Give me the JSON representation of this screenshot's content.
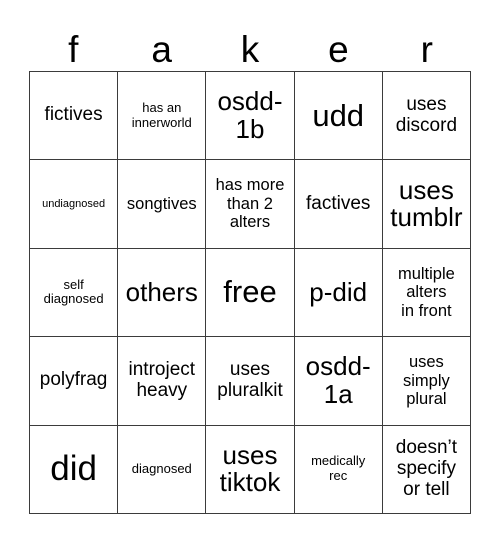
{
  "card": {
    "title_letters": [
      "f",
      "a",
      "k",
      "e",
      "r"
    ],
    "columns": 5,
    "rows": 5,
    "border_color": "#3b3b3b",
    "background_color": "#ffffff",
    "text_color": "#000000"
  },
  "cells": [
    {
      "text": "fictives",
      "size": "l"
    },
    {
      "text": "has an\ninnerworld",
      "size": "s"
    },
    {
      "text": "osdd-\n1b",
      "size": "xxl"
    },
    {
      "text": "udd",
      "size": "3xl"
    },
    {
      "text": "uses\ndiscord",
      "size": "l"
    },
    {
      "text": "undiagnosed",
      "size": "xs"
    },
    {
      "text": "songtives",
      "size": "m"
    },
    {
      "text": "has more\nthan 2\nalters",
      "size": "m"
    },
    {
      "text": "factives",
      "size": "l"
    },
    {
      "text": "uses\ntumblr",
      "size": "xxl"
    },
    {
      "text": "self\ndiagnosed",
      "size": "s"
    },
    {
      "text": "others",
      "size": "xxl"
    },
    {
      "text": "free",
      "size": "3xl"
    },
    {
      "text": "p-did",
      "size": "xxl"
    },
    {
      "text": "multiple\nalters\nin front",
      "size": "m"
    },
    {
      "text": "polyfrag",
      "size": "l"
    },
    {
      "text": "introject\nheavy",
      "size": "l"
    },
    {
      "text": "uses\npluralkit",
      "size": "l"
    },
    {
      "text": "osdd-\n1a",
      "size": "xxl"
    },
    {
      "text": "uses\nsimply\nplural",
      "size": "m"
    },
    {
      "text": "did",
      "size": "4xl"
    },
    {
      "text": "diagnosed",
      "size": "s"
    },
    {
      "text": "uses\ntiktok",
      "size": "xxl"
    },
    {
      "text": "medically\nrec",
      "size": "s"
    },
    {
      "text": "doesn’t\nspecify\nor tell",
      "size": "l"
    }
  ]
}
